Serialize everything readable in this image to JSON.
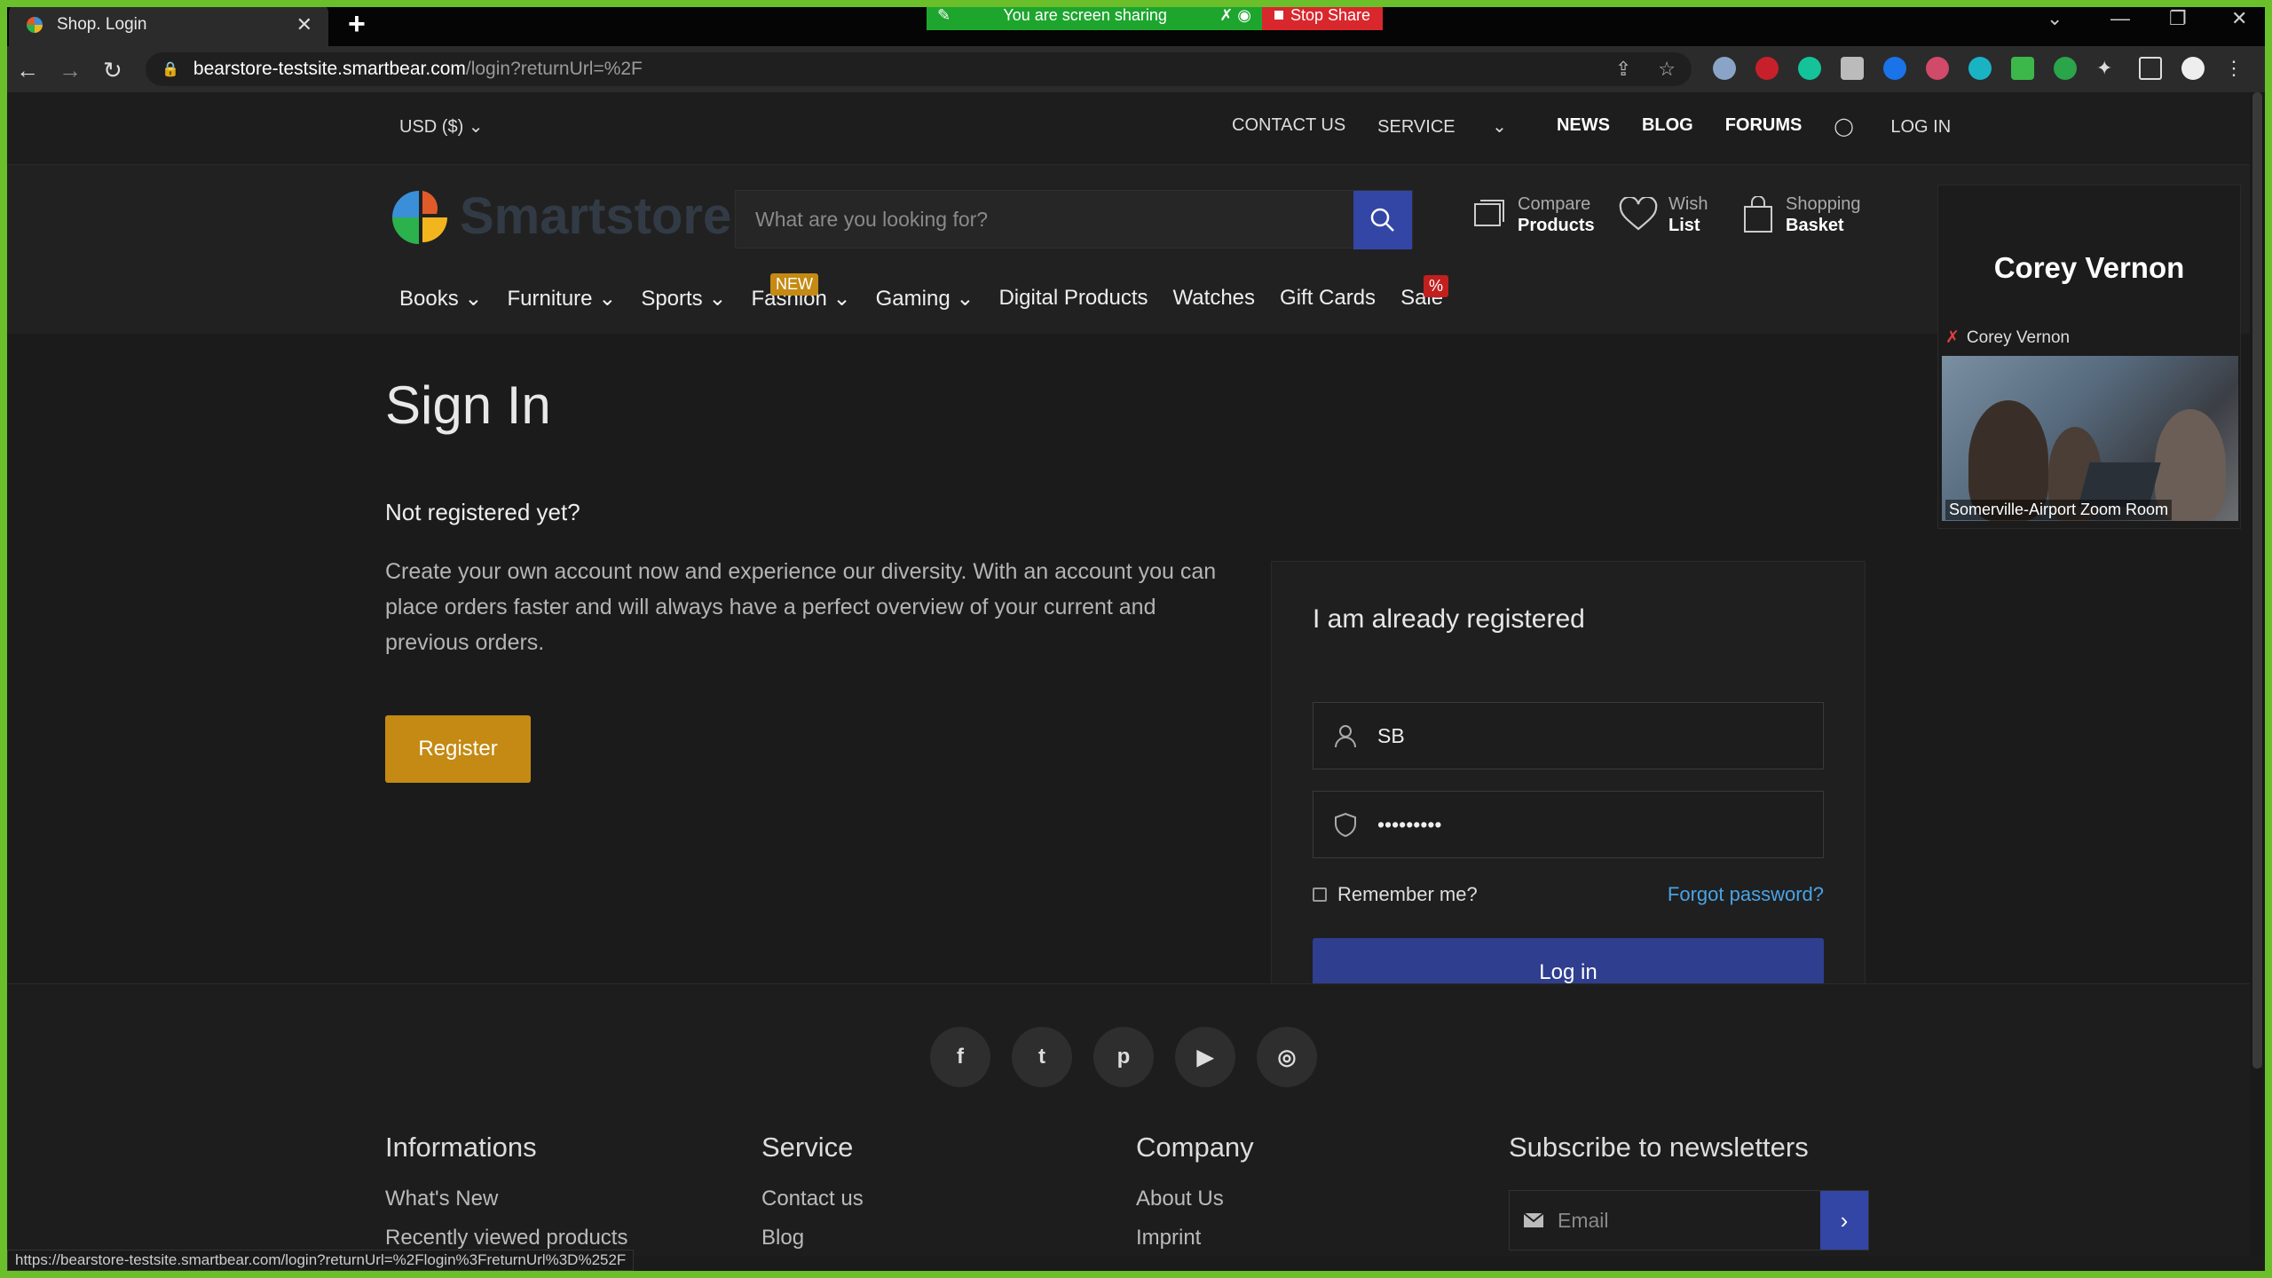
{
  "browser": {
    "tab_title": "Shop. Login",
    "url_host": "bearstore-testsite.smartbear.com",
    "url_path": "/login?returnUrl=%2F",
    "status_url": "https://bearstore-testsite.smartbear.com/login?returnUrl=%2Flogin%3FreturnUrl%3D%252F"
  },
  "screen_share": {
    "banner": "You are screen sharing",
    "stop": "Stop Share"
  },
  "topbar": {
    "currency": "USD  ($)",
    "links": [
      "CONTACT US",
      "SERVICE"
    ],
    "bold_links": [
      "NEWS",
      "BLOG",
      "FORUMS"
    ],
    "login": "LOG IN"
  },
  "header": {
    "logo": "Smartstore",
    "search_placeholder": "What are you looking for?",
    "compare_top": "Compare",
    "compare_bottom": "Products",
    "wish_top": "Wish",
    "wish_bottom": "List",
    "basket_top": "Shopping",
    "basket_bottom": "Basket"
  },
  "menu": {
    "items": [
      "Books",
      "Furniture",
      "Sports",
      "Fashion",
      "Gaming",
      "Digital Products",
      "Watches",
      "Gift Cards",
      "Sale"
    ],
    "badge_new": "NEW",
    "badge_sale": "%"
  },
  "main": {
    "title": "Sign In",
    "not_registered": "Not registered yet?",
    "register_text": "Create your own account now and experience our diversity. With an account you can place orders faster and will always have a perfect overview of your current and previous orders.",
    "register_button": "Register"
  },
  "login": {
    "title": "I am already registered",
    "username_value": "SB",
    "password_value": "•••••••••",
    "remember": "Remember me?",
    "forgot": "Forgot password?",
    "button": "Log in"
  },
  "footer": {
    "socials": [
      "f",
      "t",
      "p",
      "▶",
      "◎"
    ],
    "col1_title": "Informations",
    "col1_items": [
      "What's New",
      "Recently viewed products"
    ],
    "col2_title": "Service",
    "col2_items": [
      "Contact us",
      "Blog"
    ],
    "col3_title": "Company",
    "col3_items": [
      "About Us",
      "Imprint"
    ],
    "col4_title": "Subscribe to newsletters",
    "email_placeholder": "Email"
  },
  "zoom": {
    "participant": "Corey Vernon",
    "sub_name": "Corey Vernon",
    "room": "Somerville-Airport Zoom Room"
  },
  "colors": {
    "accent_blue": "#3346a5",
    "accent_gold": "#c48a13",
    "share_green": "#1ea52e",
    "stop_red": "#d9272e",
    "frame_green": "#6abf2a"
  }
}
